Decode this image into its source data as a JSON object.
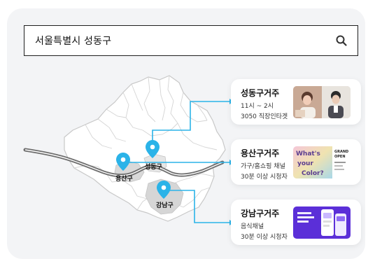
{
  "search": {
    "query": "서울특별시 성동구"
  },
  "colors": {
    "accent": "#2bb3e8",
    "map_fill": "#ffffff",
    "map_stroke": "#cfcfcf",
    "map_highlight": "#d9d9d9",
    "river": "#707070"
  },
  "districts": {
    "seongdong": "성동구",
    "yongsan": "용산구",
    "gangnam": "강남구"
  },
  "cards": [
    {
      "title": "성동구거주",
      "line1": "11시 ~ 2시",
      "line2": "3050 직장인타겟"
    },
    {
      "title": "용산구거주",
      "line1": "가구/홈쇼핑 채널",
      "line2": "30분 이상 시청자"
    },
    {
      "title": "강남구거주",
      "line1": "음식채널",
      "line2": "30분 이상 시청자"
    }
  ],
  "thumbs": {
    "yongsan_text_a": "What's",
    "yongsan_text_b": "your",
    "yongsan_text_c": "Color?",
    "yongsan_side_a": "GRAND",
    "yongsan_side_b": "OPEN"
  }
}
